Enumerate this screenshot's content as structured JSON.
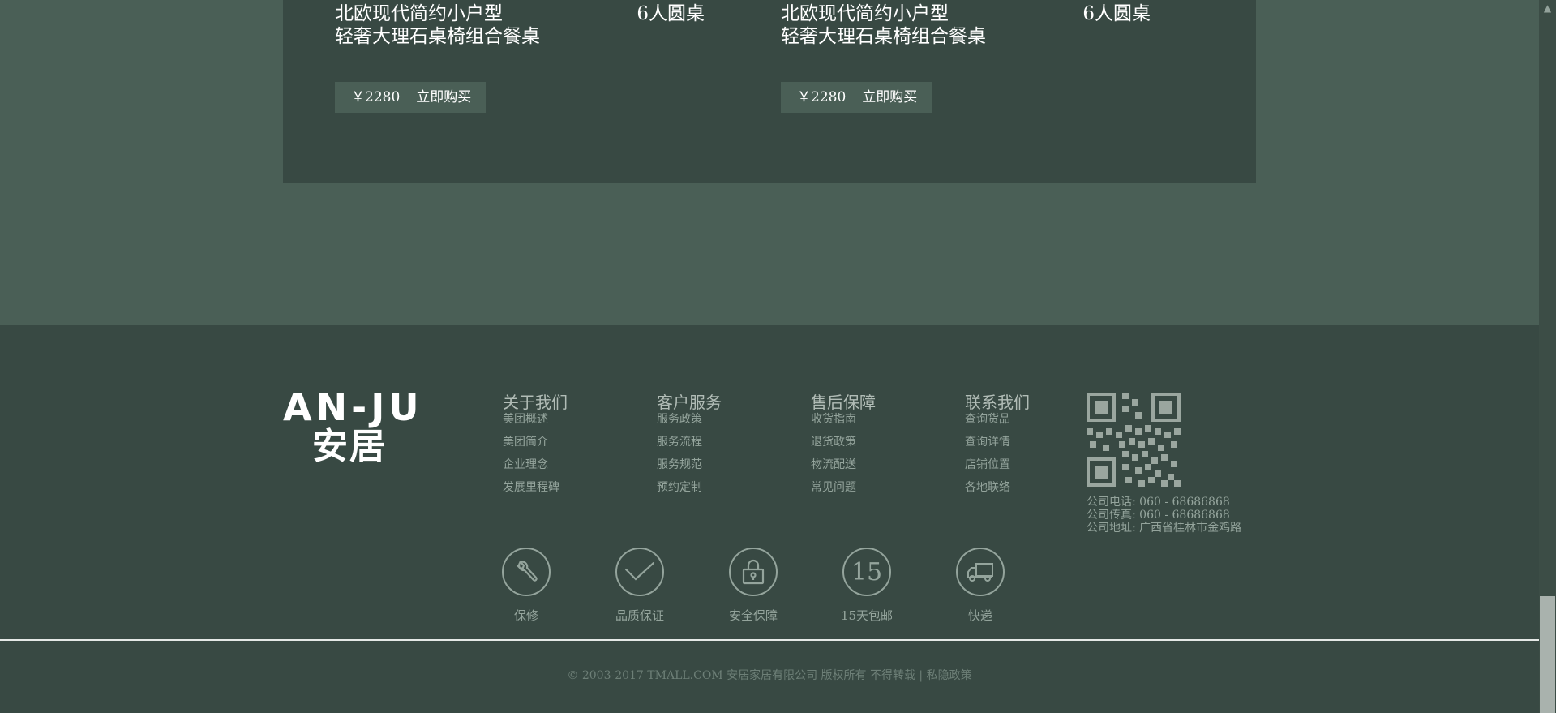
{
  "products": [
    {
      "title_line1": "北欧现代简约小户型",
      "title_line2": "轻奢大理石桌椅组合餐桌",
      "size": "6人圆桌",
      "price": "￥2280",
      "buy_label": "立即购买"
    },
    {
      "title_line1": "北欧现代简约小户型",
      "title_line2": "轻奢大理石桌椅组合餐桌",
      "size": "6人圆桌",
      "price": "￥2280",
      "buy_label": "立即购买"
    }
  ],
  "footer": {
    "logo_en": "AN-JU",
    "logo_cn": "安居",
    "columns": [
      {
        "title": "关于我们",
        "links": [
          "美团概述",
          "美团简介",
          "企业理念",
          "发展里程碑"
        ]
      },
      {
        "title": "客户服务",
        "links": [
          "服务政策",
          "服务流程",
          "服务规范",
          "预约定制"
        ]
      },
      {
        "title": "售后保障",
        "links": [
          "收货指南",
          "退货政策",
          "物流配送",
          "常见问题"
        ]
      },
      {
        "title": "联系我们",
        "links": [
          "查询货品",
          "查询详情",
          "店铺位置",
          "各地联络"
        ]
      }
    ],
    "contact": {
      "phone": "公司电话: 060 - 68686868",
      "fax": "公司传真: 060 - 68686868",
      "address": "公司地址: 广西省桂林市金鸡路"
    },
    "services": [
      {
        "label": "保修",
        "icon": "wrench-icon"
      },
      {
        "label": "品质保证",
        "icon": "check-icon"
      },
      {
        "label": "安全保障",
        "icon": "lock-icon"
      },
      {
        "label": "15天包邮",
        "icon": "fifteen-icon",
        "glyph": "15"
      },
      {
        "label": "快递",
        "icon": "truck-icon"
      }
    ],
    "copyright": "© 2003-2017 TMALL.COM 安居家居有限公司 版权所有 不得转载 | 私隐政策"
  },
  "scrollbar": {
    "up_arrow": "▲"
  },
  "colors": {
    "page_bg": "#4a5f56",
    "panel_bg": "#384943",
    "footer_bg": "#384943",
    "text_muted": "#94a49c"
  }
}
